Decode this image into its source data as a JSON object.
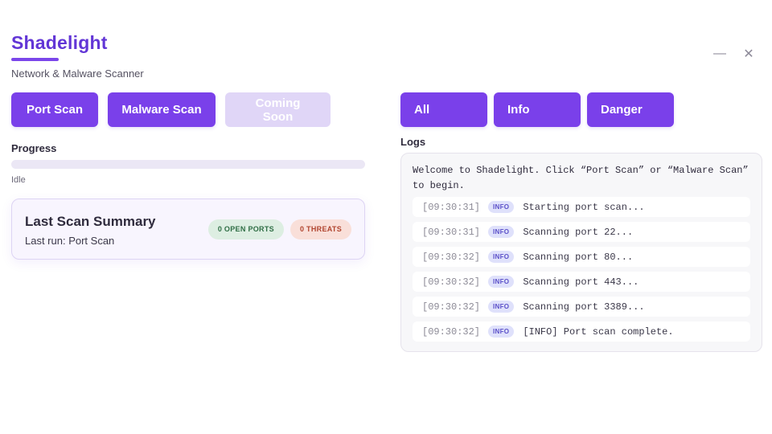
{
  "app": {
    "title": "Shadelight",
    "subtitle": "Network & Malware Scanner",
    "accent_color": "#7a40ea",
    "title_color": "#6236d6"
  },
  "window_controls": {
    "minimize_icon": "minimize-icon",
    "minimize_glyph": "—",
    "close_icon": "close-icon",
    "close_glyph": "✕"
  },
  "scan_buttons": {
    "port_scan": "Port Scan",
    "malware_scan": "Malware Scan",
    "coming_soon": "Coming Soon"
  },
  "progress": {
    "label": "Progress",
    "status": "Idle",
    "percent": 0
  },
  "summary": {
    "title": "Last Scan Summary",
    "last_run": "Last run: Port Scan",
    "open_ports_badge": "0 OPEN PORTS",
    "threats_badge": "0 THREATS"
  },
  "filters": {
    "all": "All",
    "info": "Info",
    "danger": "Danger"
  },
  "logs": {
    "label": "Logs",
    "welcome": "Welcome to Shadelight. Click “Port Scan” or “Malware Scan” to begin.",
    "entries": [
      {
        "time": "[09:30:31]",
        "level": "INFO",
        "message": "Starting port scan..."
      },
      {
        "time": "[09:30:31]",
        "level": "INFO",
        "message": "Scanning port 22..."
      },
      {
        "time": "[09:30:32]",
        "level": "INFO",
        "message": "Scanning port 80..."
      },
      {
        "time": "[09:30:32]",
        "level": "INFO",
        "message": "Scanning port 443..."
      },
      {
        "time": "[09:30:32]",
        "level": "INFO",
        "message": "Scanning port 3389..."
      },
      {
        "time": "[09:30:32]",
        "level": "INFO",
        "message": "[INFO] Port scan complete."
      }
    ]
  }
}
